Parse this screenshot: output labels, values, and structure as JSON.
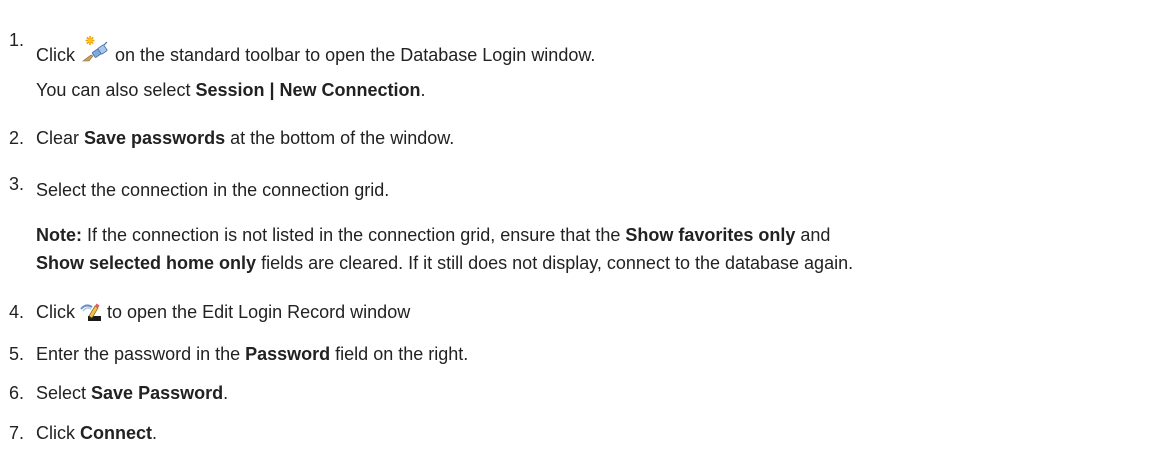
{
  "steps": [
    {
      "number": "1.",
      "parts": [
        "Click ",
        " on the standard toolbar to open the Database Login window."
      ],
      "subline": {
        "prefix": "You can also select ",
        "bold": "Session | New Connection",
        "suffix": "."
      },
      "icon": "new-connection-icon"
    },
    {
      "number": "2.",
      "prefix": "Clear ",
      "bold": "Save passwords",
      "suffix": " at the bottom of the window."
    },
    {
      "number": "3.",
      "text": "Select the connection in the connection grid.",
      "note": {
        "label": "Note:",
        "line1_a": " If the connection is not listed in the connection grid, ensure that the ",
        "line1_bold": "Show favorites only",
        "line1_b": " and",
        "line2_bold": "Show selected home only",
        "line2_a": " fields are cleared. If it still does not display, connect to the database again."
      }
    },
    {
      "number": "4.",
      "prefix": "Click ",
      "suffix": " to open the Edit Login Record window",
      "icon": "edit-login-record-icon"
    },
    {
      "number": "5.",
      "prefix": "Enter the password in the ",
      "bold": "Password",
      "suffix": " field on the right."
    },
    {
      "number": "6.",
      "prefix": "Select ",
      "bold": "Save Password",
      "suffix": "."
    },
    {
      "number": "7.",
      "prefix": "Click ",
      "bold": "Connect",
      "suffix": "."
    }
  ]
}
